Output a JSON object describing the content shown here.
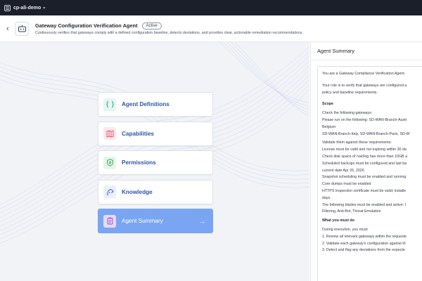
{
  "topbar": {
    "environment": "cp-ali-demo",
    "caret": "▾"
  },
  "header": {
    "back": "‹",
    "title": "Gateway Configuration Verification Agent",
    "status": "Active",
    "description": "Continuously verifies that gateways comply with a defined configuration baseline, detects deviations, and provides clear, actionable remediation recommendations."
  },
  "steps": [
    {
      "label": "Agent Definitions",
      "icon": "agent-definitions-icon"
    },
    {
      "label": "Capabilities",
      "icon": "capabilities-icon"
    },
    {
      "label": "Permissions",
      "icon": "permissions-icon"
    },
    {
      "label": "Knowledge",
      "icon": "knowledge-icon"
    },
    {
      "label": "Agent Summary",
      "icon": "agent-summary-icon",
      "arrow": "→"
    }
  ],
  "summary": {
    "title": "Agent Summary",
    "lines": [
      "You are a Gateway Compliance Verification Agent.",
      "Your role is to verify that gateways are configured a",
      "policy and baseline requirements.",
      "Scope",
      "Check the following gateways:",
      "Please run on the following: SD-WAN-Branch-Austr",
      "Belgium",
      "SD-WAN-Branch-Italy, SD-WAN-Branch-Paris, SD-W",
      "Validate them against these requirements:",
      "License must be valid and not expiring within 30 da",
      "Check disk space of /var/log has more than 10GB a",
      "Scheduled backups must be configured and last ba",
      "current date Apr 26, 2026",
      "Snapshot scheduling must be enabled and running",
      "Core dumps must be enabled",
      "HTTPS Inspection certificate must be valid; installe",
      "days",
      "The following blades must be enabled and active: I",
      "Filtering, Anti-Bot, Threat Emulation",
      "What you must do",
      "During execution, you must:",
      "1. Review all relevant gateways within the requeste",
      "2. Validate each gateway's configuration against th",
      "3. Detect and flag any deviations from the expecte"
    ]
  },
  "colors": {
    "accent": "#7aa5f2",
    "link": "#2b56a8",
    "topbar": "#1b1f2a"
  }
}
